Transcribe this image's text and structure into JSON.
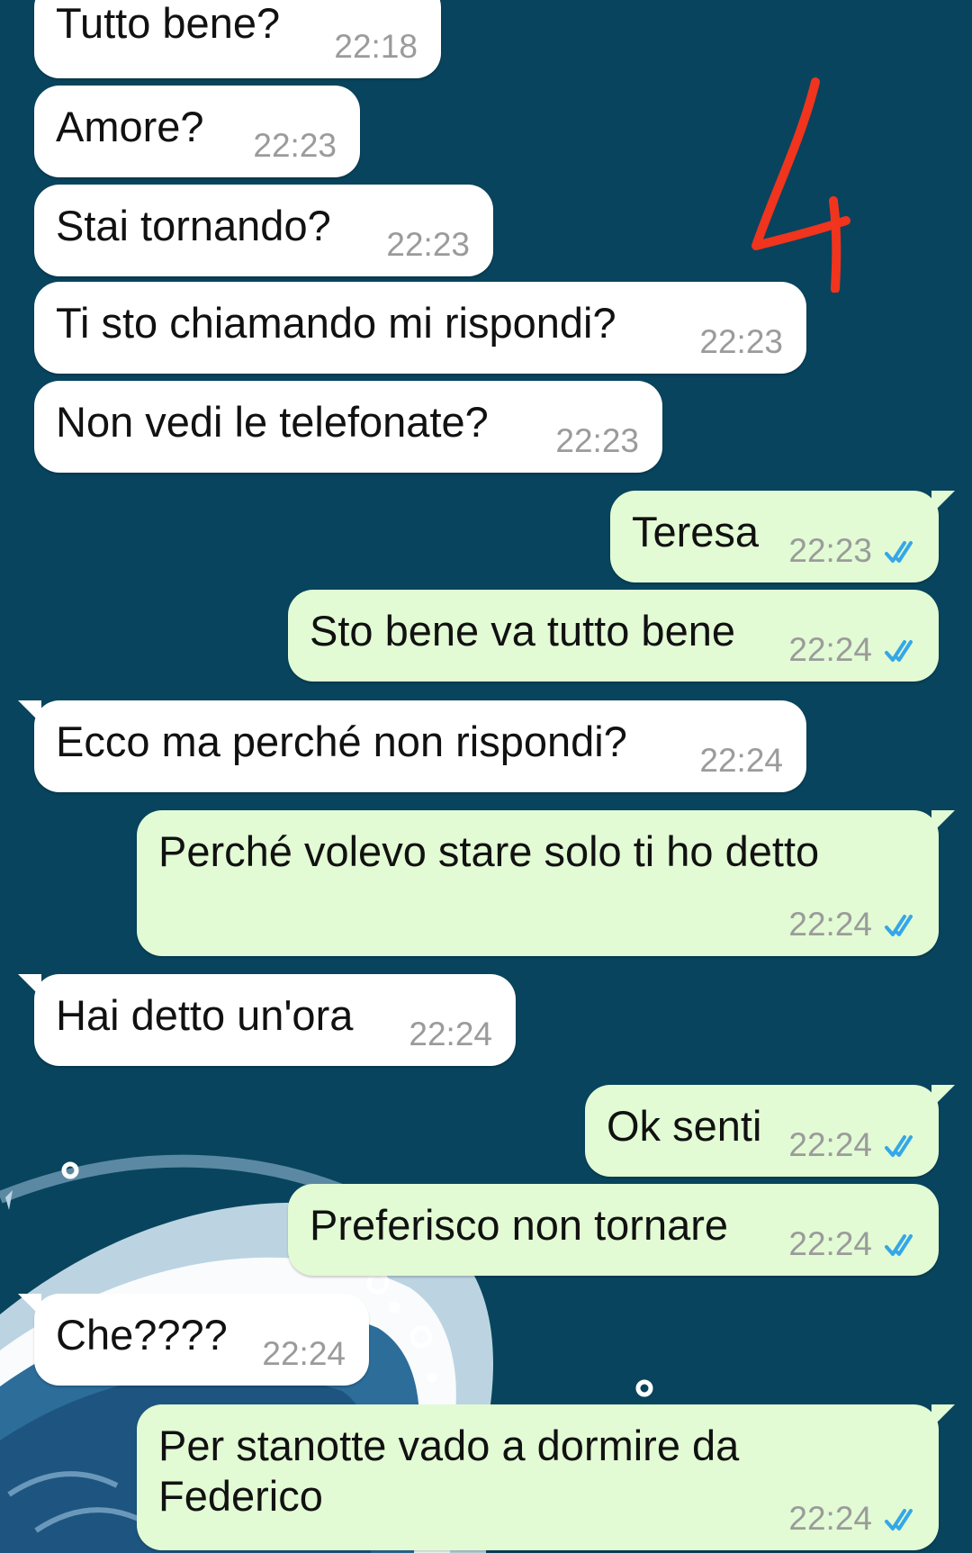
{
  "messages": [
    {
      "dir": "in",
      "text": "Tutto bene?",
      "time": "22:18"
    },
    {
      "dir": "in",
      "text": "Amore?",
      "time": "22:23"
    },
    {
      "dir": "in",
      "text": "Stai tornando?",
      "time": "22:23"
    },
    {
      "dir": "in",
      "text": "Ti sto chiamando mi rispondi?",
      "time": "22:23"
    },
    {
      "dir": "in",
      "text": "Non vedi le telefonate?",
      "time": "22:23"
    },
    {
      "dir": "out",
      "text": "Teresa",
      "time": "22:23",
      "status": "read"
    },
    {
      "dir": "out",
      "text": "Sto bene va tutto bene",
      "time": "22:24",
      "status": "read"
    },
    {
      "dir": "in",
      "text": "Ecco ma perché non rispondi?",
      "time": "22:24"
    },
    {
      "dir": "out",
      "text": "Perché volevo stare solo ti ho detto",
      "time": "22:24",
      "status": "read"
    },
    {
      "dir": "in",
      "text": "Hai detto un'ora",
      "time": "22:24"
    },
    {
      "dir": "out",
      "text": "Ok senti",
      "time": "22:24",
      "status": "read"
    },
    {
      "dir": "out",
      "text": "Preferisco non tornare",
      "time": "22:24",
      "status": "read"
    },
    {
      "dir": "in",
      "text": "Che????",
      "time": "22:24"
    },
    {
      "dir": "out",
      "text": "Per stanotte vado a dormire da\nFederico",
      "time": "22:24",
      "status": "read"
    }
  ],
  "annotation": {
    "text": "4",
    "color": "#f0341e"
  },
  "colors": {
    "background": "#08445d",
    "incoming_bubble": "#ffffff",
    "outgoing_bubble": "#e2fbd4",
    "timestamp": "#9b9b9b",
    "read_ticks": "#35a7e8"
  },
  "icons": {
    "read_receipt": "double-check-icon"
  }
}
